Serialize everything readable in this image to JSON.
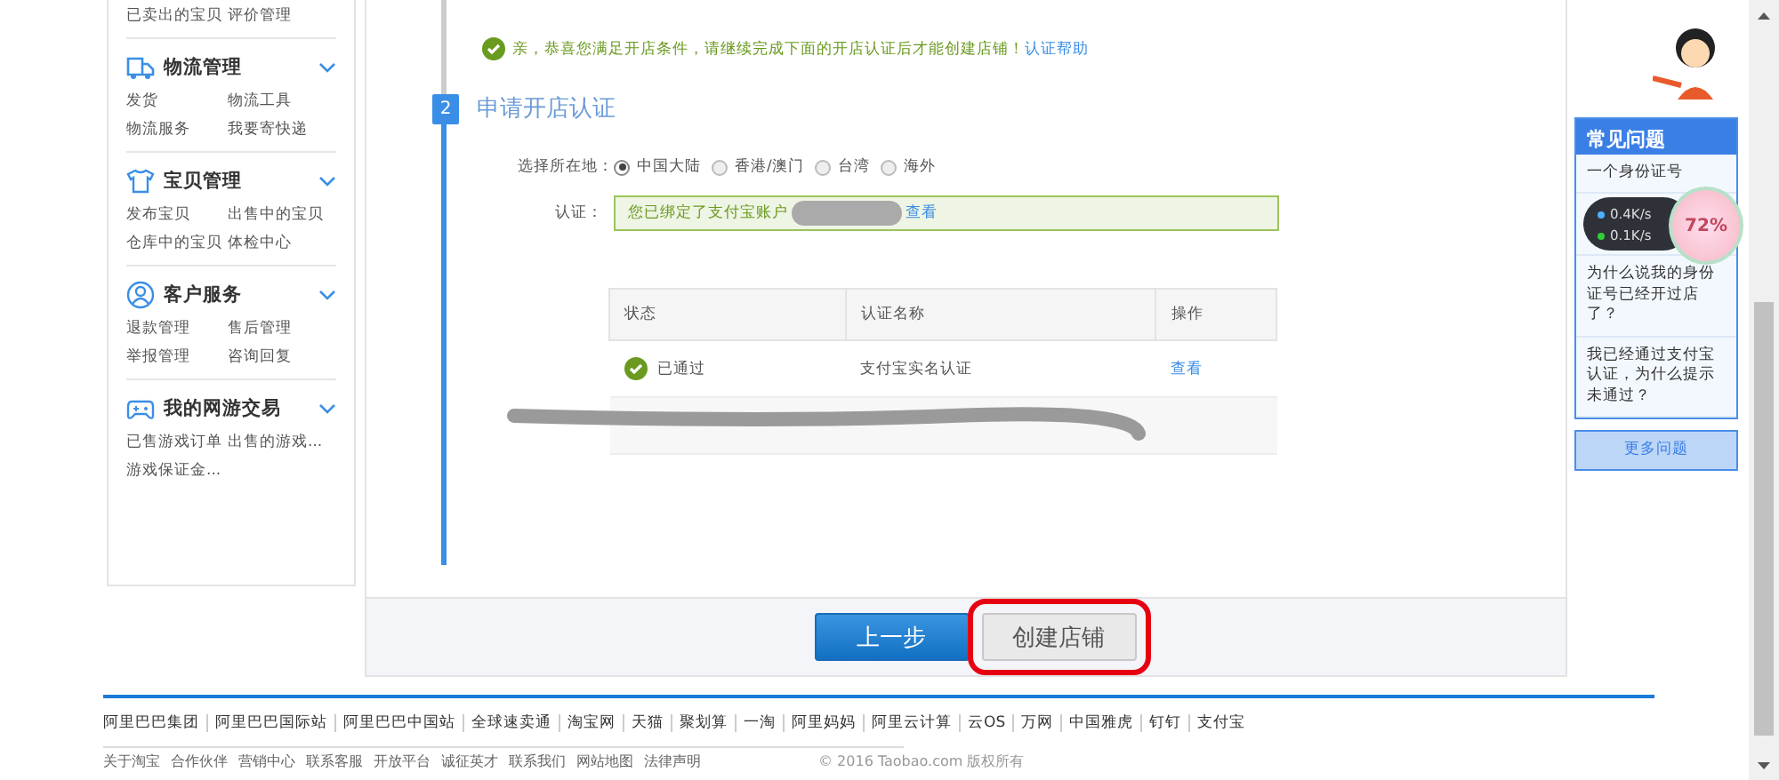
{
  "sidebar": {
    "groups": [
      {
        "links": [
          "已卖出的宝贝",
          "评价管理"
        ]
      },
      {
        "title": "物流管理",
        "links": [
          "发货",
          "物流工具",
          "物流服务",
          "我要寄快递"
        ]
      },
      {
        "title": "宝贝管理",
        "links": [
          "发布宝贝",
          "出售中的宝贝",
          "仓库中的宝贝",
          "体检中心"
        ]
      },
      {
        "title": "客户服务",
        "links": [
          "退款管理",
          "售后管理",
          "举报管理",
          "咨询回复"
        ]
      },
      {
        "title": "我的网游交易",
        "links": [
          "已售游戏订单",
          "出售的游戏...",
          "游戏保证金..."
        ]
      }
    ]
  },
  "notice": {
    "text": "亲，恭喜您满足开店条件，请继续完成下面的开店认证后才能创建店铺！",
    "link": "认证帮助"
  },
  "step": {
    "number": "2",
    "title": "申请开店认证"
  },
  "location": {
    "label": "选择所在地：",
    "options": [
      {
        "label": "中国大陆",
        "selected": true
      },
      {
        "label": "香港/澳门",
        "selected": false
      },
      {
        "label": "台湾",
        "selected": false
      },
      {
        "label": "海外",
        "selected": false
      }
    ]
  },
  "certification": {
    "label": "认证：",
    "text": "您已绑定了支付宝账户",
    "link": "查看"
  },
  "table": {
    "columns": [
      "状态",
      "认证名称",
      "操作"
    ],
    "rows": [
      {
        "status": "已通过",
        "passed": true,
        "name": "支付宝实名认证",
        "action": "查看"
      }
    ]
  },
  "buttons": [
    {
      "label": "上一步",
      "kind": "primary",
      "highlighted": false
    },
    {
      "label": "创建店铺",
      "kind": "secondary",
      "highlighted": true
    }
  ],
  "faq": {
    "title": "常见问题",
    "items": [
      "一个身份证号",
      "为什么说我的身份证号已经开过店了？",
      "我已经通过支付宝认证，为什么提示未通过？"
    ],
    "more": "更多问题"
  },
  "speed_widget": {
    "upload": "0.4K/s",
    "download": "0.1K/s",
    "percent": "72%"
  },
  "footer": {
    "links": [
      "阿里巴巴集团",
      "阿里巴巴国际站",
      "阿里巴巴中国站",
      "全球速卖通",
      "淘宝网",
      "天猫",
      "聚划算",
      "一淘",
      "阿里妈妈",
      "阿里云计算",
      "云OS",
      "万网",
      "中国雅虎",
      "钉钉",
      "支付宝"
    ],
    "links_2": [
      "关于淘宝",
      "合作伙伴",
      "营销中心",
      "联系客服",
      "开放平台",
      "诚征英才",
      "联系我们",
      "网站地图",
      "法律声明"
    ],
    "copyright": "© 2016 Taobao.com 版权所有"
  }
}
